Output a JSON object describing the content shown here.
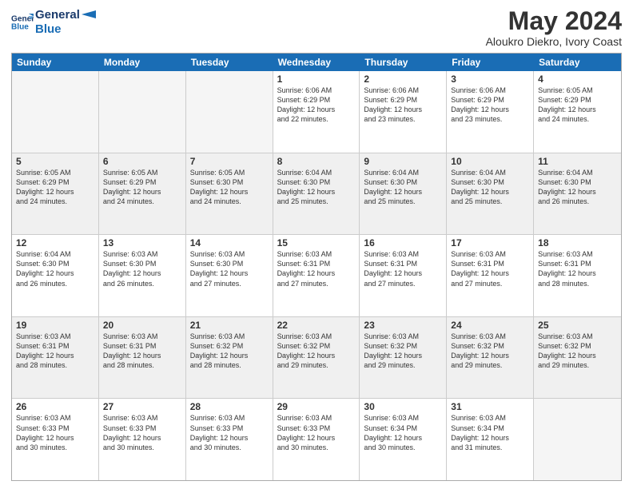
{
  "logo": {
    "line1": "General",
    "line2": "Blue"
  },
  "header": {
    "month_year": "May 2024",
    "location": "Aloukro Diekro, Ivory Coast"
  },
  "weekdays": [
    "Sunday",
    "Monday",
    "Tuesday",
    "Wednesday",
    "Thursday",
    "Friday",
    "Saturday"
  ],
  "weeks": [
    [
      {
        "day": "",
        "empty": true
      },
      {
        "day": "",
        "empty": true
      },
      {
        "day": "",
        "empty": true
      },
      {
        "day": "1",
        "info": "Sunrise: 6:06 AM\nSunset: 6:29 PM\nDaylight: 12 hours\nand 22 minutes."
      },
      {
        "day": "2",
        "info": "Sunrise: 6:06 AM\nSunset: 6:29 PM\nDaylight: 12 hours\nand 23 minutes."
      },
      {
        "day": "3",
        "info": "Sunrise: 6:06 AM\nSunset: 6:29 PM\nDaylight: 12 hours\nand 23 minutes."
      },
      {
        "day": "4",
        "info": "Sunrise: 6:05 AM\nSunset: 6:29 PM\nDaylight: 12 hours\nand 24 minutes."
      }
    ],
    [
      {
        "day": "5",
        "info": "Sunrise: 6:05 AM\nSunset: 6:29 PM\nDaylight: 12 hours\nand 24 minutes."
      },
      {
        "day": "6",
        "info": "Sunrise: 6:05 AM\nSunset: 6:29 PM\nDaylight: 12 hours\nand 24 minutes."
      },
      {
        "day": "7",
        "info": "Sunrise: 6:05 AM\nSunset: 6:30 PM\nDaylight: 12 hours\nand 24 minutes."
      },
      {
        "day": "8",
        "info": "Sunrise: 6:04 AM\nSunset: 6:30 PM\nDaylight: 12 hours\nand 25 minutes."
      },
      {
        "day": "9",
        "info": "Sunrise: 6:04 AM\nSunset: 6:30 PM\nDaylight: 12 hours\nand 25 minutes."
      },
      {
        "day": "10",
        "info": "Sunrise: 6:04 AM\nSunset: 6:30 PM\nDaylight: 12 hours\nand 25 minutes."
      },
      {
        "day": "11",
        "info": "Sunrise: 6:04 AM\nSunset: 6:30 PM\nDaylight: 12 hours\nand 26 minutes."
      }
    ],
    [
      {
        "day": "12",
        "info": "Sunrise: 6:04 AM\nSunset: 6:30 PM\nDaylight: 12 hours\nand 26 minutes."
      },
      {
        "day": "13",
        "info": "Sunrise: 6:03 AM\nSunset: 6:30 PM\nDaylight: 12 hours\nand 26 minutes."
      },
      {
        "day": "14",
        "info": "Sunrise: 6:03 AM\nSunset: 6:30 PM\nDaylight: 12 hours\nand 27 minutes."
      },
      {
        "day": "15",
        "info": "Sunrise: 6:03 AM\nSunset: 6:31 PM\nDaylight: 12 hours\nand 27 minutes."
      },
      {
        "day": "16",
        "info": "Sunrise: 6:03 AM\nSunset: 6:31 PM\nDaylight: 12 hours\nand 27 minutes."
      },
      {
        "day": "17",
        "info": "Sunrise: 6:03 AM\nSunset: 6:31 PM\nDaylight: 12 hours\nand 27 minutes."
      },
      {
        "day": "18",
        "info": "Sunrise: 6:03 AM\nSunset: 6:31 PM\nDaylight: 12 hours\nand 28 minutes."
      }
    ],
    [
      {
        "day": "19",
        "info": "Sunrise: 6:03 AM\nSunset: 6:31 PM\nDaylight: 12 hours\nand 28 minutes."
      },
      {
        "day": "20",
        "info": "Sunrise: 6:03 AM\nSunset: 6:31 PM\nDaylight: 12 hours\nand 28 minutes."
      },
      {
        "day": "21",
        "info": "Sunrise: 6:03 AM\nSunset: 6:32 PM\nDaylight: 12 hours\nand 28 minutes."
      },
      {
        "day": "22",
        "info": "Sunrise: 6:03 AM\nSunset: 6:32 PM\nDaylight: 12 hours\nand 29 minutes."
      },
      {
        "day": "23",
        "info": "Sunrise: 6:03 AM\nSunset: 6:32 PM\nDaylight: 12 hours\nand 29 minutes."
      },
      {
        "day": "24",
        "info": "Sunrise: 6:03 AM\nSunset: 6:32 PM\nDaylight: 12 hours\nand 29 minutes."
      },
      {
        "day": "25",
        "info": "Sunrise: 6:03 AM\nSunset: 6:32 PM\nDaylight: 12 hours\nand 29 minutes."
      }
    ],
    [
      {
        "day": "26",
        "info": "Sunrise: 6:03 AM\nSunset: 6:33 PM\nDaylight: 12 hours\nand 30 minutes."
      },
      {
        "day": "27",
        "info": "Sunrise: 6:03 AM\nSunset: 6:33 PM\nDaylight: 12 hours\nand 30 minutes."
      },
      {
        "day": "28",
        "info": "Sunrise: 6:03 AM\nSunset: 6:33 PM\nDaylight: 12 hours\nand 30 minutes."
      },
      {
        "day": "29",
        "info": "Sunrise: 6:03 AM\nSunset: 6:33 PM\nDaylight: 12 hours\nand 30 minutes."
      },
      {
        "day": "30",
        "info": "Sunrise: 6:03 AM\nSunset: 6:34 PM\nDaylight: 12 hours\nand 30 minutes."
      },
      {
        "day": "31",
        "info": "Sunrise: 6:03 AM\nSunset: 6:34 PM\nDaylight: 12 hours\nand 31 minutes."
      },
      {
        "day": "",
        "empty": true
      }
    ]
  ]
}
